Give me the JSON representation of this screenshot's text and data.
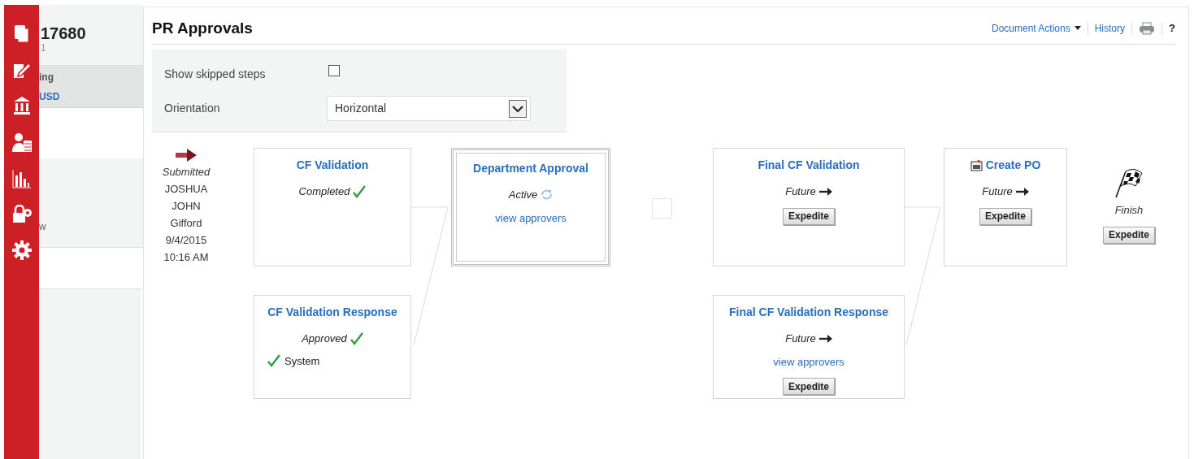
{
  "left_panel": {
    "title": "17680",
    "subtitle": "1",
    "sections": [
      {
        "label": "ing",
        "value": "USD",
        "selected": true
      },
      {
        "label": "w",
        "selected": false
      }
    ]
  },
  "header": {
    "title": "PR Approvals",
    "actions": [
      {
        "kind": "menu",
        "label": "Document Actions"
      },
      {
        "kind": "link",
        "label": "History"
      },
      {
        "kind": "print"
      },
      {
        "kind": "help",
        "label": "?"
      }
    ]
  },
  "options": {
    "show_skipped_steps": {
      "label": "Show skipped steps",
      "checked": false
    },
    "orientation": {
      "label": "Orientation",
      "value": "Horizontal"
    }
  },
  "workflow": {
    "submitted": {
      "status": "Submitted",
      "lines": [
        "JOSHUA",
        "JOHN",
        "Gifford",
        "9/4/2015",
        "10:16 AM"
      ]
    },
    "stages": [
      {
        "kind": "steps",
        "steps": [
          {
            "title": "CF Validation",
            "status": "Completed",
            "kind": "completed",
            "active": false
          },
          {
            "title": "CF Validation Response",
            "status": "Approved",
            "kind": "approved",
            "approver": "System",
            "active": false
          }
        ]
      },
      {
        "kind": "steps",
        "steps": [
          {
            "title": "Department Approval",
            "status": "Active",
            "kind": "active",
            "link": "view approvers",
            "active": true
          }
        ]
      },
      {
        "kind": "placeholder"
      },
      {
        "kind": "steps",
        "steps": [
          {
            "title": "Final CF Validation",
            "status": "Future",
            "kind": "future",
            "button": "Expedite",
            "active": false
          },
          {
            "title": "Final CF Validation Response",
            "status": "Future",
            "kind": "future",
            "link": "view approvers",
            "button": "Expedite",
            "active": false
          }
        ]
      },
      {
        "kind": "steps",
        "steps": [
          {
            "title": "Create PO",
            "status": "Future",
            "kind": "future",
            "button": "Expedite",
            "po_icon": true,
            "active": false
          }
        ]
      }
    ],
    "finish": {
      "label": "Finish",
      "button": "Expedite"
    }
  }
}
